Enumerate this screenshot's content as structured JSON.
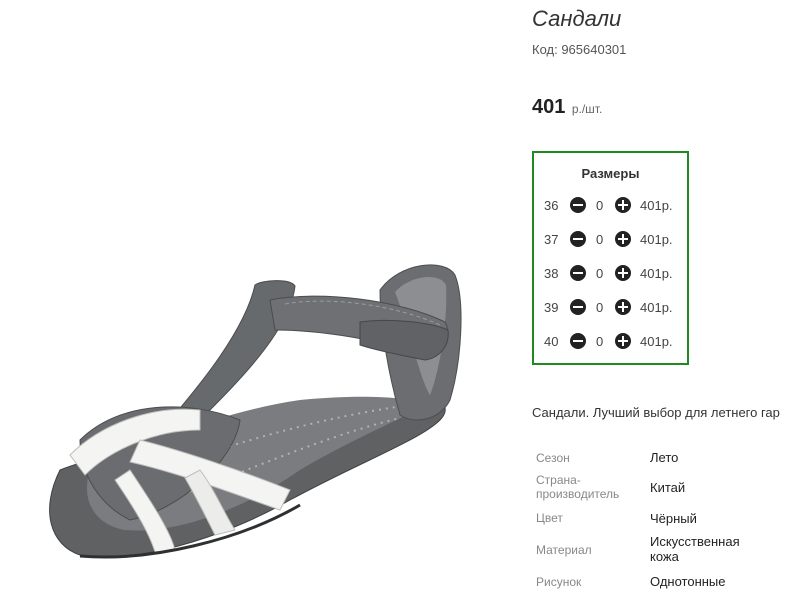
{
  "product": {
    "title": "Сандали",
    "code": "Код: 965640301",
    "price_amount": "401",
    "price_unit": "р./шт."
  },
  "sizes": {
    "heading": "Размеры",
    "rows": [
      {
        "size": "36",
        "qty": "0",
        "price": "401р."
      },
      {
        "size": "37",
        "qty": "0",
        "price": "401р."
      },
      {
        "size": "38",
        "qty": "0",
        "price": "401р."
      },
      {
        "size": "39",
        "qty": "0",
        "price": "401р."
      },
      {
        "size": "40",
        "qty": "0",
        "price": "401р."
      }
    ],
    "border_color": "#1f8a1f"
  },
  "description": "Сандали. Лучший выбор для летнего гар",
  "attributes": [
    {
      "label": "Сезон",
      "value": "Лето"
    },
    {
      "label": "Страна-\nпроизводитель",
      "value": "Китай"
    },
    {
      "label": "Цвет",
      "value": "Чёрный"
    },
    {
      "label": "Материал",
      "value": "Искусственная\nкожа"
    },
    {
      "label": "Рисунок",
      "value": "Однотонные"
    }
  ],
  "icons": {
    "minus": "minus-circle-icon",
    "plus": "plus-circle-icon"
  }
}
